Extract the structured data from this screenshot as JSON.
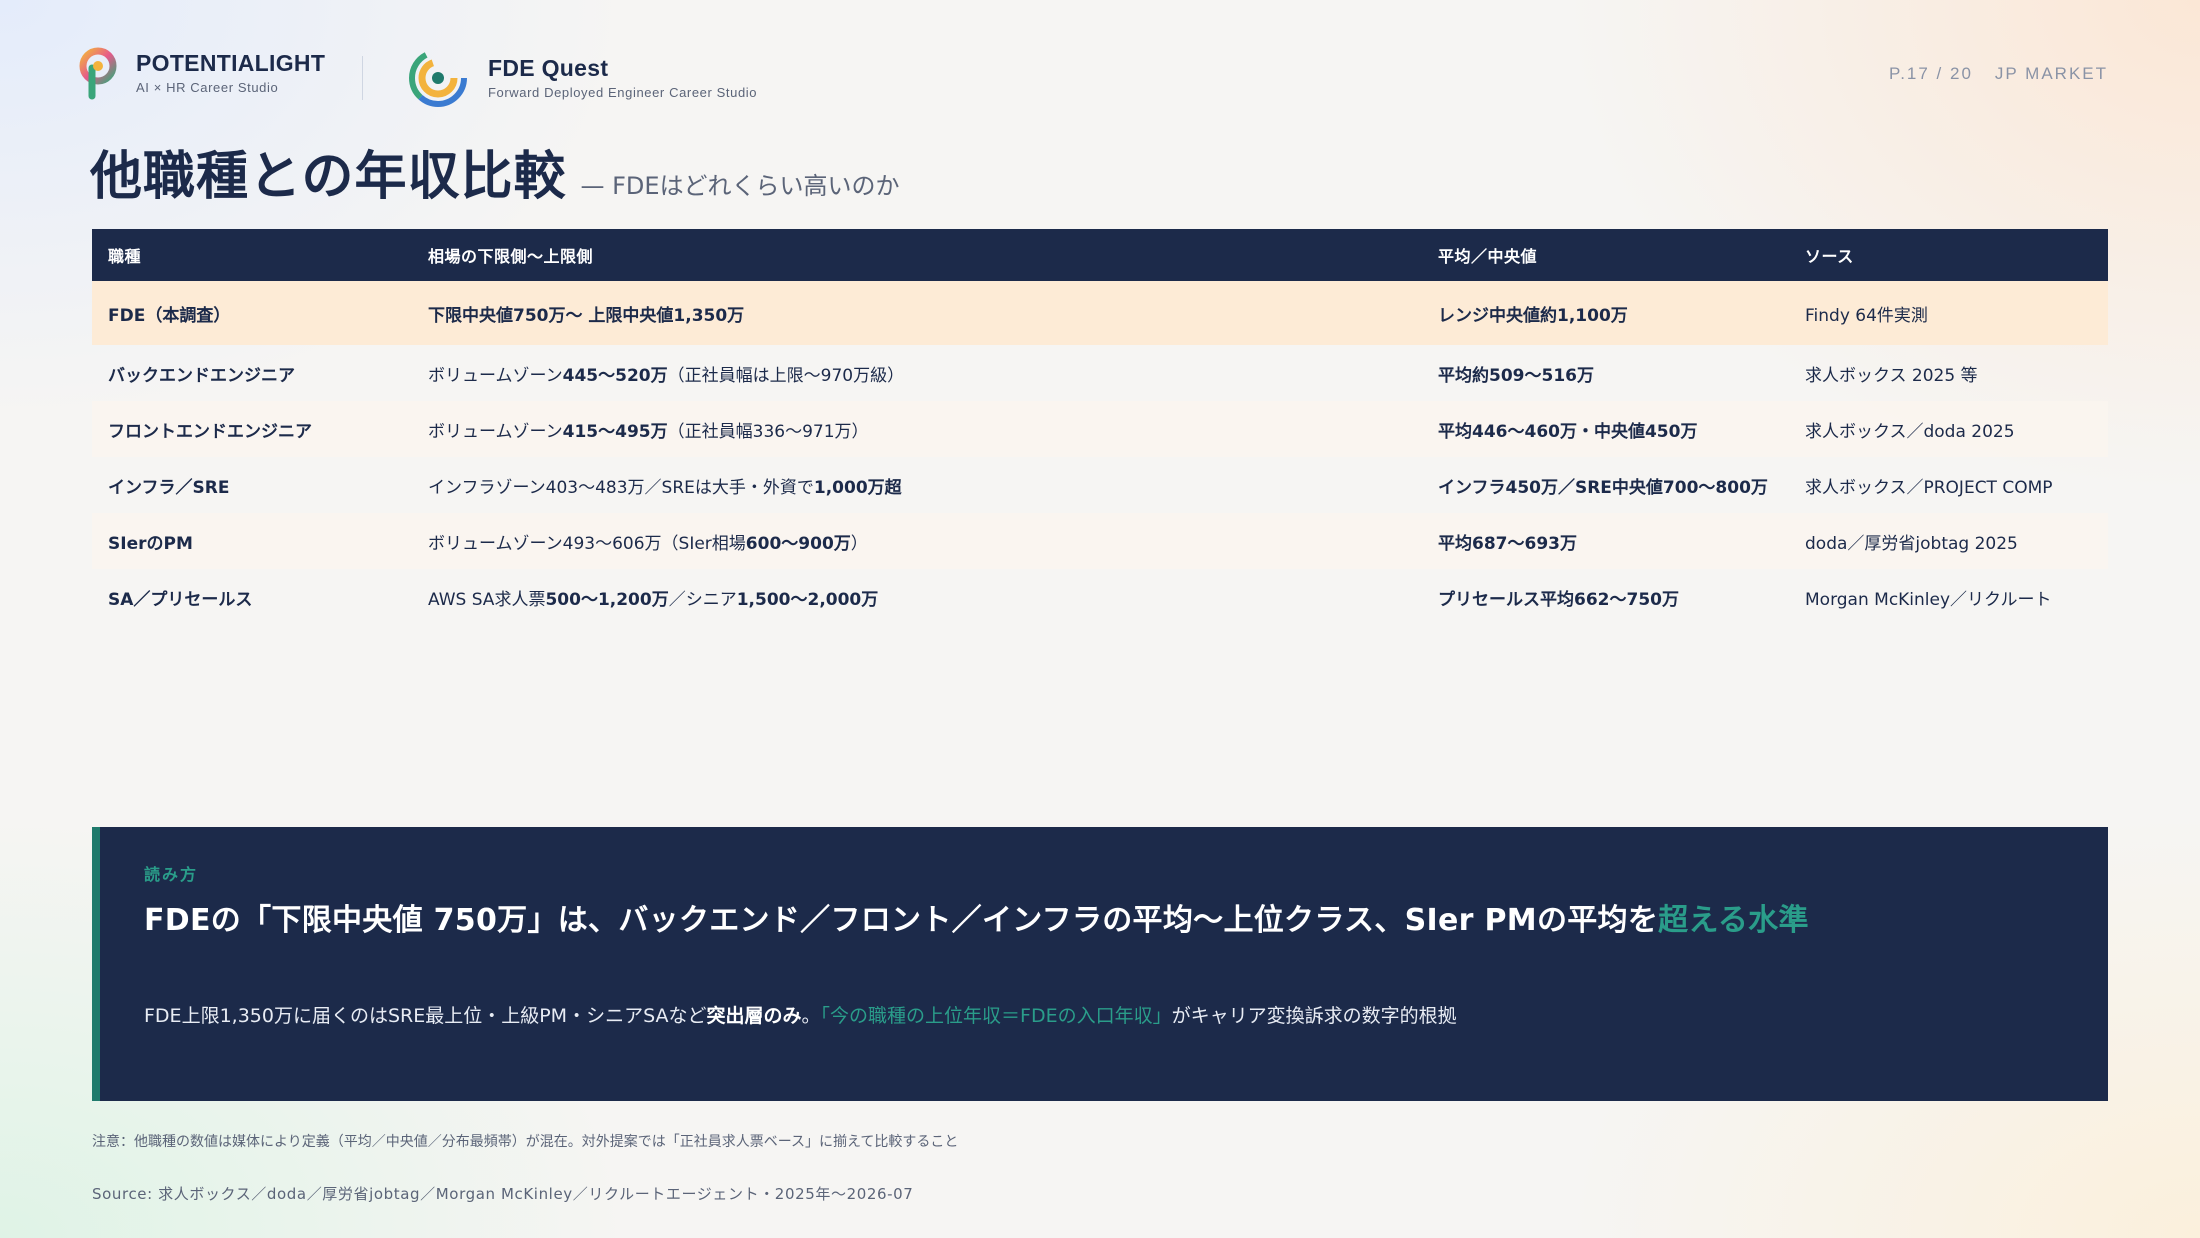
{
  "header": {
    "brand1": {
      "title": "POTENTIALIGHT",
      "subtitle": "AI × HR Career Studio"
    },
    "brand2": {
      "title": "FDE Quest",
      "subtitle": "Forward Deployed Engineer Career Studio"
    },
    "page": "P.17 / 20",
    "section": "JP MARKET"
  },
  "title": "他職種との年収比較",
  "subtitle": "— FDEはどれくらい高いのか",
  "table": {
    "headers": [
      "職種",
      "相場の下限側〜上限側",
      "平均／中央値",
      "ソース"
    ],
    "rows": [
      {
        "role": "FDE（本調査）",
        "range_parts": [
          {
            "t": "下限中央値750万〜 上限中央値1,350万",
            "b": true
          }
        ],
        "avg": "レンジ中央値約1,100万",
        "source": "Findy 64件実測"
      },
      {
        "role": "バックエンドエンジニア",
        "range_parts": [
          {
            "t": "ボリュームゾーン",
            "b": false
          },
          {
            "t": "445〜520万",
            "b": true
          },
          {
            "t": "（正社員幅は上限〜970万級）",
            "b": false
          }
        ],
        "avg": "平均約509〜516万",
        "source": "求人ボックス 2025 等"
      },
      {
        "role": "フロントエンドエンジニア",
        "range_parts": [
          {
            "t": "ボリュームゾーン",
            "b": false
          },
          {
            "t": "415〜495万",
            "b": true
          },
          {
            "t": "（正社員幅336〜971万）",
            "b": false
          }
        ],
        "avg": "平均446〜460万・中央値450万",
        "source": "求人ボックス／doda 2025"
      },
      {
        "role": "インフラ／SRE",
        "range_parts": [
          {
            "t": "インフラゾーン403〜483万／SREは大手・外資で",
            "b": false
          },
          {
            "t": "1,000万超",
            "b": true
          }
        ],
        "avg": "インフラ450万／SRE中央値700〜800万",
        "source": "求人ボックス／PROJECT COMP"
      },
      {
        "role": "SIerのPM",
        "range_parts": [
          {
            "t": "ボリュームゾーン493〜606万（SIer相場",
            "b": false
          },
          {
            "t": "600〜900万",
            "b": true
          },
          {
            "t": "）",
            "b": false
          }
        ],
        "avg": "平均687〜693万",
        "source": "doda／厚労省jobtag 2025"
      },
      {
        "role": "SA／プリセールス",
        "range_parts": [
          {
            "t": "AWS SA求人票",
            "b": false
          },
          {
            "t": "500〜1,200万",
            "b": true
          },
          {
            "t": "／シニア",
            "b": false
          },
          {
            "t": "1,500〜2,000万",
            "b": true
          }
        ],
        "avg": "プリセールス平均662〜750万",
        "source": "Morgan McKinley／リクルート"
      }
    ]
  },
  "insight": {
    "label": "読み方",
    "headline_main": "FDEの「下限中央値 750万」は、バックエンド／フロント／インフラの平均〜上位クラス、SIer PMの平均を",
    "headline_highlight": "超える水準",
    "body_1": "FDE上限1,350万に届くのはSRE最上位・上級PM・シニアSAなど",
    "body_bold": "突出層のみ",
    "body_2": "。",
    "body_green": "「今の職種の上位年収＝FDEの入口年収」",
    "body_3": "がキャリア変換訴求の数字的根拠"
  },
  "note": "注意：他職種の数値は媒体により定義（平均／中央値／分布最頻帯）が混在。対外提案では「正社員求人票ベース」に揃えて比較すること",
  "source": "Source: 求人ボックス／doda／厚労省jobtag／Morgan McKinley／リクルートエージェント・2025年〜2026-07",
  "colors": {
    "navy": "#1c2a4a",
    "teal": "#1f7a6c",
    "highlight_row": "#fdebd6"
  }
}
